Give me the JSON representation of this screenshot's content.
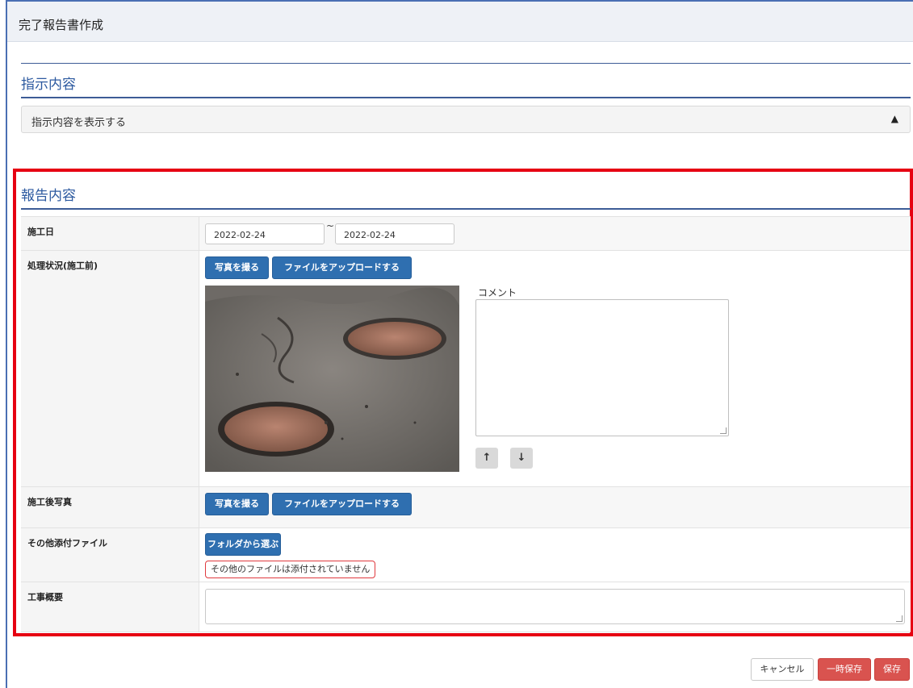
{
  "header": {
    "title": "完了報告書作成"
  },
  "instruction": {
    "heading": "指示内容",
    "toggle_label": "指示内容を表示する",
    "toggle_caret": "▲"
  },
  "report": {
    "heading": "報告内容",
    "work_date": {
      "label": "施工日",
      "start": "2022-02-24",
      "separator": "~",
      "end": "2022-02-24"
    },
    "before_photos": {
      "label": "処理状況(施工前)",
      "take_photo_label": "写真を撮る",
      "upload_label": "ファイルをアップロードする",
      "comment_label": "コメント",
      "comment_value": "",
      "move_up": "↑",
      "move_down": "↓"
    },
    "after_photos": {
      "label": "施工後写真",
      "take_photo_label": "写真を撮る",
      "upload_label": "ファイルをアップロードする"
    },
    "other_files": {
      "label": "その他添付ファイル",
      "choose_folder_label": "フォルダから選ぶ",
      "empty_notice": "その他のファイルは添付されていません"
    },
    "summary": {
      "label": "工事概要",
      "value": ""
    }
  },
  "footer": {
    "cancel_label": "キャンセル",
    "temp_save_label": "一時保存",
    "save_label": "保存"
  },
  "colors": {
    "accent_blue": "#2f6fb0",
    "heading_blue": "#2d5aa0",
    "danger_red": "#d9534f",
    "highlight_red": "#e60012"
  }
}
